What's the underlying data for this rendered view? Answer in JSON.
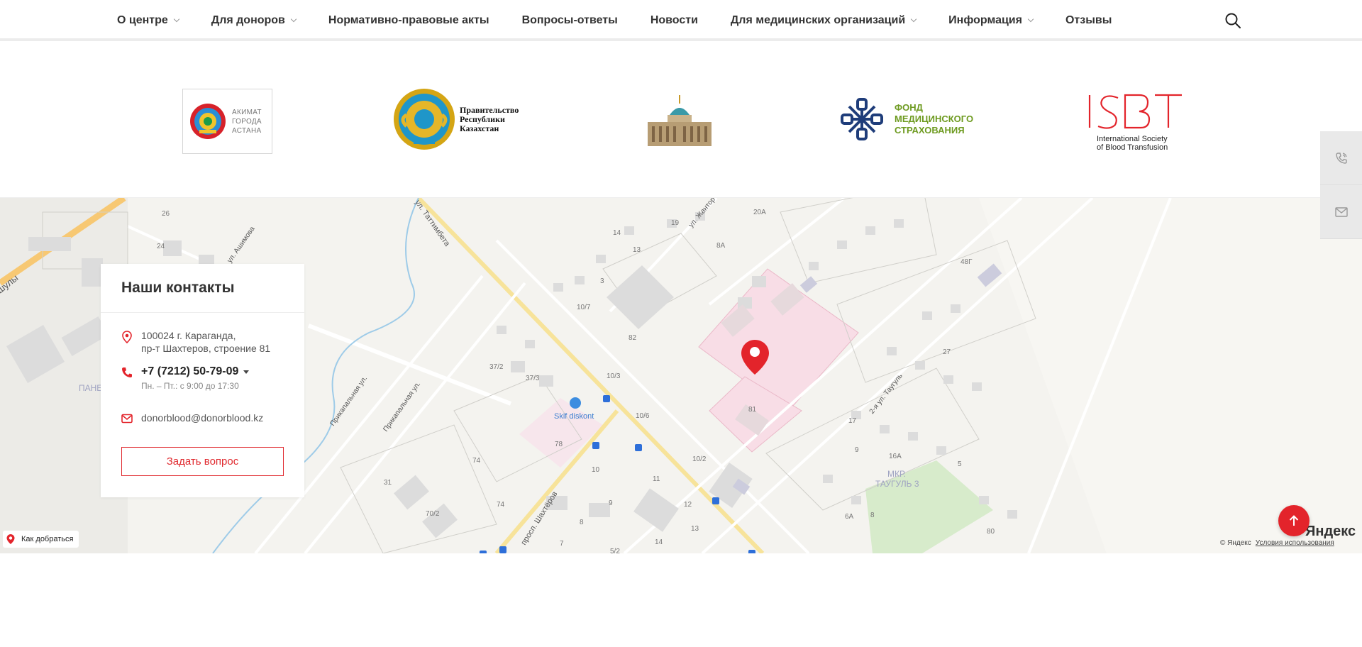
{
  "nav": {
    "items": [
      {
        "label": "О центре",
        "has_dropdown": true
      },
      {
        "label": "Для доноров",
        "has_dropdown": true
      },
      {
        "label": "Нормативно-правовые акты",
        "has_dropdown": false
      },
      {
        "label": "Вопросы-ответы",
        "has_dropdown": false
      },
      {
        "label": "Новости",
        "has_dropdown": false
      },
      {
        "label": "Для медицинских организаций",
        "has_dropdown": true
      },
      {
        "label": "Информация",
        "has_dropdown": true
      },
      {
        "label": "Отзывы",
        "has_dropdown": false
      }
    ],
    "search_icon": "search-icon"
  },
  "partners": {
    "akimat": {
      "line1": "АКИМАТ",
      "line2": "ГОРОДА",
      "line3": "АСТАНА"
    },
    "government": {
      "line1": "Правительство",
      "line2": "Республики",
      "line3": "Казахстан"
    },
    "fond": {
      "line1": "ФОНД",
      "line2": "МЕДИЦИНСКОГО",
      "line3": "СТРАХОВАНИЯ"
    },
    "isbt": {
      "mark": "ISBT",
      "line1": "International Society",
      "line2": "of Blood Transfusion"
    }
  },
  "contacts": {
    "title": "Наши контакты",
    "address_line1": "100024 г. Караганда,",
    "address_line2": "пр-т Шахтеров, строение 81",
    "phone": "+7 (7212) 50-79-09",
    "hours": "Пн. – Пт.: с 9:00 до 17:30",
    "email": "donorblood@donorblood.kz",
    "ask_button": "Задать вопрос"
  },
  "map": {
    "route_label": "Как добраться",
    "copyright": "© Яндекс",
    "terms": "Условия использования",
    "brand": "Яндекс",
    "labels": {
      "street1": "ул. Таттимбета",
      "street2": "просп. Шахтёров",
      "street3": "Прикапальная ул.",
      "street4": "Прикапальная ул.",
      "street5": "2-я ул. Таугуль",
      "street6": "ул. Жантор",
      "street7": "ул. Ашимова",
      "street8": "шулы",
      "district1": "МКР.",
      "district2": "ТАУГУЛЬ 3",
      "district3": "ПАНЕ",
      "shop": "Skif diskont",
      "b1": "26",
      "b2": "24",
      "b3": "19",
      "b4": "20А",
      "b5": "14",
      "b6": "13",
      "b7": "8А",
      "b8": "3",
      "b9": "10/7",
      "b10": "82",
      "b11": "37/2",
      "b12": "37/3",
      "b13": "10/3",
      "b14": "10/6",
      "b15": "81",
      "b16": "78",
      "b17": "10/2",
      "b18": "74",
      "b19": "10",
      "b20": "11",
      "b21": "31",
      "b22": "74",
      "b23": "9",
      "b24": "12",
      "b25": "70/2",
      "b26": "8",
      "b27": "13",
      "b28": "7",
      "b29": "5/2",
      "b30": "14",
      "b31": "48Г",
      "b32": "27",
      "b33": "17",
      "b34": "9",
      "b35": "16А",
      "b36": "5",
      "b37": "6А",
      "b38": "8",
      "b39": "80"
    }
  },
  "colors": {
    "accent": "#e3242b",
    "fond_green": "#6d9a1f",
    "fond_blue": "#1f3d7a"
  }
}
